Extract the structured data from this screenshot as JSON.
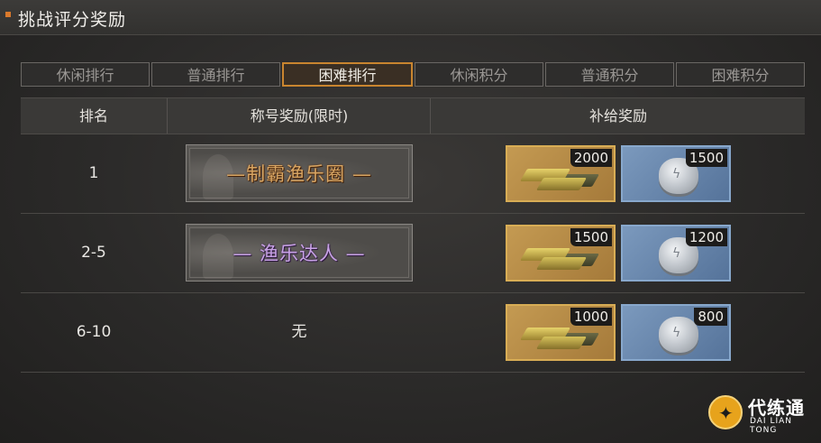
{
  "header": {
    "title": "挑战评分奖励"
  },
  "tabs": [
    {
      "label": "休闲排行",
      "active": false
    },
    {
      "label": "普通排行",
      "active": false
    },
    {
      "label": "困难排行",
      "active": true
    },
    {
      "label": "休闲积分",
      "active": false
    },
    {
      "label": "普通积分",
      "active": false
    },
    {
      "label": "困难积分",
      "active": false
    }
  ],
  "table": {
    "headers": {
      "rank": "排名",
      "title_reward": "称号奖励(限时)",
      "supply_reward": "补给奖励"
    },
    "rows": [
      {
        "rank": "1",
        "title": "—制霸渔乐圈 —",
        "title_style": "bronze",
        "gold": "2000",
        "silver": "1500"
      },
      {
        "rank": "2-5",
        "title": "— 渔乐达人 —",
        "title_style": "purple",
        "gold": "1500",
        "silver": "1200"
      },
      {
        "rank": "6-10",
        "title": "无",
        "title_style": "none",
        "gold": "1000",
        "silver": "800"
      }
    ]
  },
  "item_icons": {
    "gold": "gold-bars-icon",
    "silver": "silver-coin-icon"
  },
  "colors": {
    "accent": "#d9792c",
    "active_tab_border": "#c9852f",
    "gold_frame": "#d8ad55",
    "silver_frame": "#88a8cc"
  },
  "logo": {
    "name": "代练通",
    "subtitle": "DAI LIAN TONG"
  }
}
